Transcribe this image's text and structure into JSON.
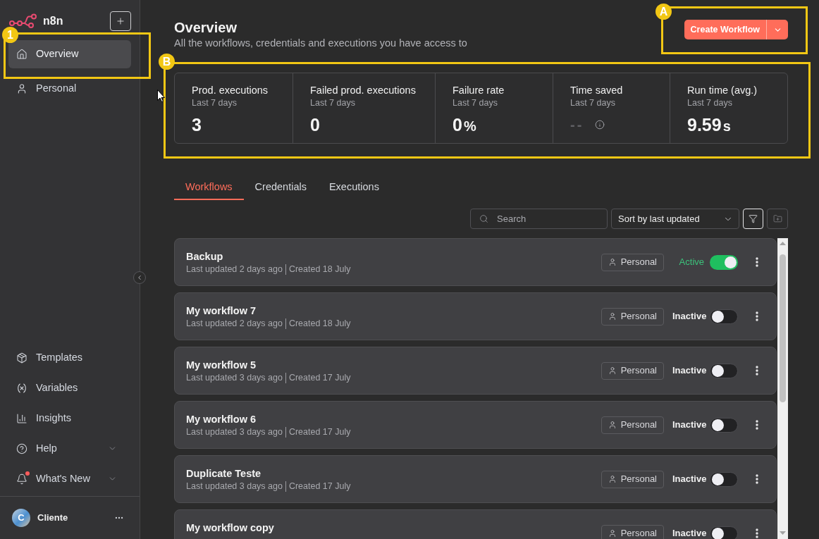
{
  "sidebar": {
    "brand": "n8n",
    "nav": [
      {
        "label": "Overview",
        "selected": true
      },
      {
        "label": "Personal",
        "selected": false
      }
    ],
    "links": [
      {
        "label": "Templates",
        "expandable": false,
        "notification": false
      },
      {
        "label": "Variables",
        "expandable": false,
        "notification": false
      },
      {
        "label": "Insights",
        "expandable": false,
        "notification": false
      },
      {
        "label": "Help",
        "expandable": true,
        "notification": false
      },
      {
        "label": "What's New",
        "expandable": true,
        "notification": true
      }
    ],
    "user": {
      "initial": "C",
      "name": "Cliente"
    }
  },
  "header": {
    "title": "Overview",
    "subtitle": "All the workflows, credentials and executions you have access to",
    "create_button": "Create Workflow"
  },
  "stats": [
    {
      "label": "Prod. executions",
      "period": "Last 7 days",
      "value": "3",
      "muted": false
    },
    {
      "label": "Failed prod. executions",
      "period": "Last 7 days",
      "value": "0",
      "muted": false
    },
    {
      "label": "Failure rate",
      "period": "Last 7 days",
      "value": "0",
      "unit": "%",
      "muted": false
    },
    {
      "label": "Time saved",
      "period": "Last 7 days",
      "value": "--",
      "muted": true
    },
    {
      "label": "Run time (avg.)",
      "period": "Last 7 days",
      "value": "9.59",
      "unit": "s",
      "muted": false
    }
  ],
  "tabs": [
    {
      "label": "Workflows",
      "selected": true
    },
    {
      "label": "Credentials",
      "selected": false
    },
    {
      "label": "Executions",
      "selected": false
    }
  ],
  "toolbar": {
    "search_placeholder": "Search",
    "sort": "Sort by last updated",
    "filter_selected": true,
    "folder_disabled": true
  },
  "workflows": [
    {
      "name": "Backup",
      "updated": "Last updated 2 days ago",
      "created": "Created 18 July",
      "owner": "Personal",
      "status": "Active",
      "active": true
    },
    {
      "name": "My workflow 7",
      "updated": "Last updated 2 days ago",
      "created": "Created 18 July",
      "owner": "Personal",
      "status": "Inactive",
      "active": false
    },
    {
      "name": "My workflow 5",
      "updated": "Last updated 3 days ago",
      "created": "Created 17 July",
      "owner": "Personal",
      "status": "Inactive",
      "active": false
    },
    {
      "name": "My workflow 6",
      "updated": "Last updated 3 days ago",
      "created": "Created 17 July",
      "owner": "Personal",
      "status": "Inactive",
      "active": false
    },
    {
      "name": "Duplicate Teste",
      "updated": "Last updated 3 days ago",
      "created": "Created 17 July",
      "owner": "Personal",
      "status": "Inactive",
      "active": false
    },
    {
      "name": "My workflow copy",
      "owner": "Personal",
      "status": "Inactive",
      "active": false
    }
  ],
  "annotations": [
    {
      "label": "1"
    },
    {
      "label": "A"
    },
    {
      "label": "B"
    }
  ]
}
